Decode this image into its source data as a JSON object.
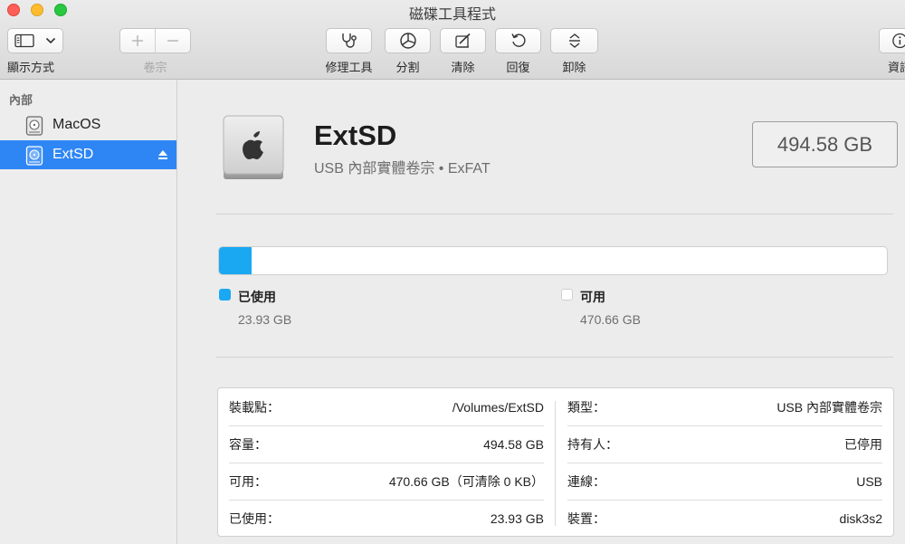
{
  "window": {
    "title": "磁碟工具程式"
  },
  "toolbar": {
    "view_label": "顯示方式",
    "volume_label": "卷宗",
    "first_aid_label": "修理工具",
    "partition_label": "分割",
    "erase_label": "清除",
    "restore_label": "回復",
    "unmount_label": "卸除",
    "info_label": "資訊"
  },
  "sidebar": {
    "section": "內部",
    "items": [
      {
        "label": "MacOS",
        "selected": false
      },
      {
        "label": "ExtSD",
        "selected": true
      }
    ]
  },
  "volume": {
    "name": "ExtSD",
    "subtitle": "USB 內部實體卷宗 • ExFAT",
    "size": "494.58 GB"
  },
  "usage": {
    "used_fraction": 0.0484,
    "used_color": "#1aa8f2",
    "used_label": "已使用",
    "used_value": "23.93 GB",
    "free_label": "可用",
    "free_value": "470.66 GB"
  },
  "info": {
    "left": [
      {
        "key": "裝載點：",
        "value": "/Volumes/ExtSD"
      },
      {
        "key": "容量：",
        "value": "494.58 GB"
      },
      {
        "key": "可用：",
        "value": "470.66 GB（可清除 0 KB）"
      },
      {
        "key": "已使用：",
        "value": "23.93 GB"
      }
    ],
    "right": [
      {
        "key": "類型：",
        "value": "USB 內部實體卷宗"
      },
      {
        "key": "持有人：",
        "value": "已停用"
      },
      {
        "key": "連線：",
        "value": "USB"
      },
      {
        "key": "裝置：",
        "value": "disk3s2"
      }
    ]
  }
}
